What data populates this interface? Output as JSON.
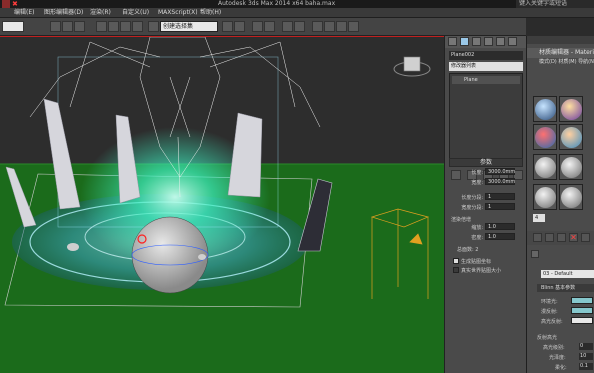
{
  "titlebar": {
    "title": "Autodesk 3ds Max  2014 x64     baha.max"
  },
  "search": {
    "placeholder": "键入关键字或短语"
  },
  "menubar": {
    "items": [
      {
        "label": "编辑(E)"
      },
      {
        "label": "图形编辑器(D)"
      },
      {
        "label": "渲染(R)"
      },
      {
        "label": "自定义(U)"
      },
      {
        "label": "MAXScript(X)"
      },
      {
        "label": "帮助(H)"
      }
    ]
  },
  "toolbar": {
    "selection_set_placeholder": "创建选择集"
  },
  "command_panel": {
    "object_name": "Plane002",
    "modifier_list": "修改器列表",
    "stack_item": "Plane",
    "params_title": "参数",
    "length_label": "长度:",
    "length_value": "3000.0mm",
    "width_label": "宽度:",
    "width_value": "3000.0mm",
    "length_segs_label": "长度分段:",
    "length_segs_value": "1",
    "width_segs_label": "宽度分段:",
    "width_segs_value": "1",
    "render_multipliers_label": "渲染倍增",
    "scale_label": "缩放:",
    "scale_value": "1.0",
    "density_label": "密度:",
    "density_value": "1.0",
    "total_faces_label": "总面数: 2",
    "gen_mapping_label": "生成贴图坐标",
    "real_world_label": "真实世界贴图大小"
  },
  "material_editor": {
    "title": "材质编辑器 - Material",
    "menu": "模式(D)  材质(M)  导航(N)",
    "material_name": "03 - Default",
    "rollout_basic": "Blinn 基本参数",
    "ambient_label": "环境光:",
    "diffuse_label": "漫反射:",
    "specular_label": "高光反射:",
    "specular_highlights": "反射高光",
    "spec_level_label": "高光级别:",
    "spec_level_value": "0",
    "gloss_label": "光泽度:",
    "gloss_value": "10",
    "soften_label": "柔化:",
    "soften_value": "0.1",
    "counter": "4"
  },
  "colors": {
    "ground": "#1b6b1b",
    "glow": "#3ef0c0",
    "magic_circle": "#3fa7d6",
    "swatch": "#86c7cc"
  }
}
